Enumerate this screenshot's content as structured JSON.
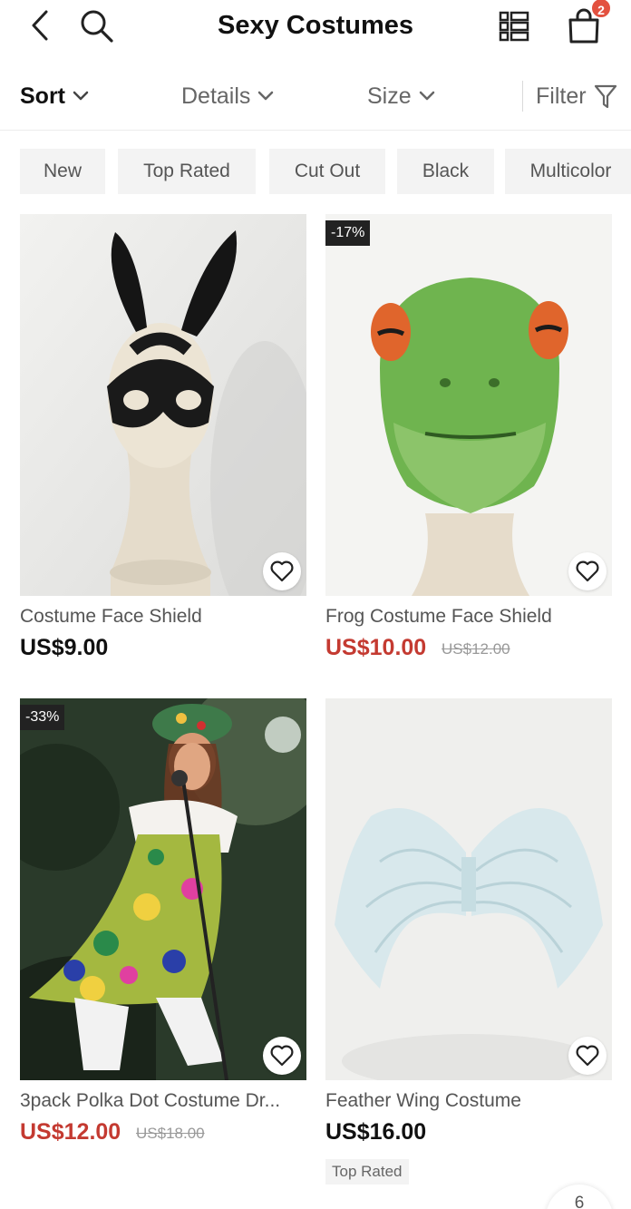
{
  "header": {
    "title": "Sexy Costumes",
    "cart_count": "2",
    "icons": {
      "back": "chevron-left-icon",
      "search": "search-icon",
      "view": "list-view-icon",
      "bag": "shopping-bag-icon"
    }
  },
  "sortbar": {
    "sort_label": "Sort",
    "details_label": "Details",
    "size_label": "Size",
    "filter_label": "Filter"
  },
  "chips": [
    "New",
    "Top Rated",
    "Cut Out",
    "Black",
    "Multicolor"
  ],
  "products": [
    {
      "name": "Costume Face Shield",
      "price": "US$9.00",
      "discount": "",
      "old_price": "",
      "tag": ""
    },
    {
      "name": "Frog Costume Face Shield",
      "price": "US$10.00",
      "discount": "-17%",
      "old_price": "US$12.00",
      "tag": ""
    },
    {
      "name": "3pack Polka Dot Costume Dr...",
      "price": "US$12.00",
      "discount": "-33%",
      "old_price": "US$18.00",
      "tag": ""
    },
    {
      "name": "Feather Wing Costume",
      "price": "US$16.00",
      "discount": "",
      "old_price": "",
      "tag": "Top Rated"
    }
  ],
  "pagination": {
    "current": "6"
  },
  "colors": {
    "sale_price": "#c43a31",
    "badge": "#e3513f",
    "chip_bg": "#f3f3f3"
  }
}
